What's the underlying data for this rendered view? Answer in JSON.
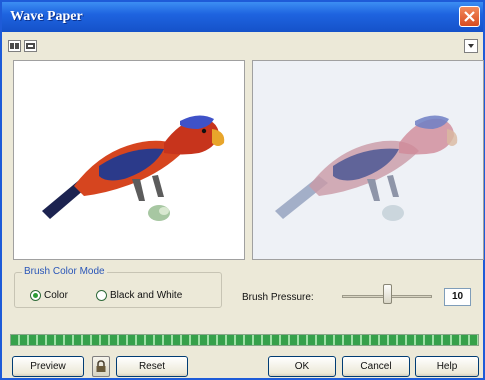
{
  "window": {
    "title": "Wave Paper"
  },
  "color_mode": {
    "legend": "Brush Color Mode",
    "options": [
      {
        "label": "Color",
        "selected": true
      },
      {
        "label": "Black and White",
        "selected": false
      }
    ]
  },
  "pressure": {
    "label": "Brush Pressure:",
    "value": "10",
    "slider_fraction": 0.5
  },
  "progress": {
    "fraction": 1.0
  },
  "buttons": {
    "preview": "Preview",
    "reset": "Reset",
    "ok": "OK",
    "cancel": "Cancel",
    "help": "Help"
  },
  "icons": {
    "close": "close-icon",
    "toolbar": [
      "dual-view-icon",
      "single-view-icon"
    ],
    "dropdown": "chevron-down-icon",
    "lock": "lock-icon"
  }
}
